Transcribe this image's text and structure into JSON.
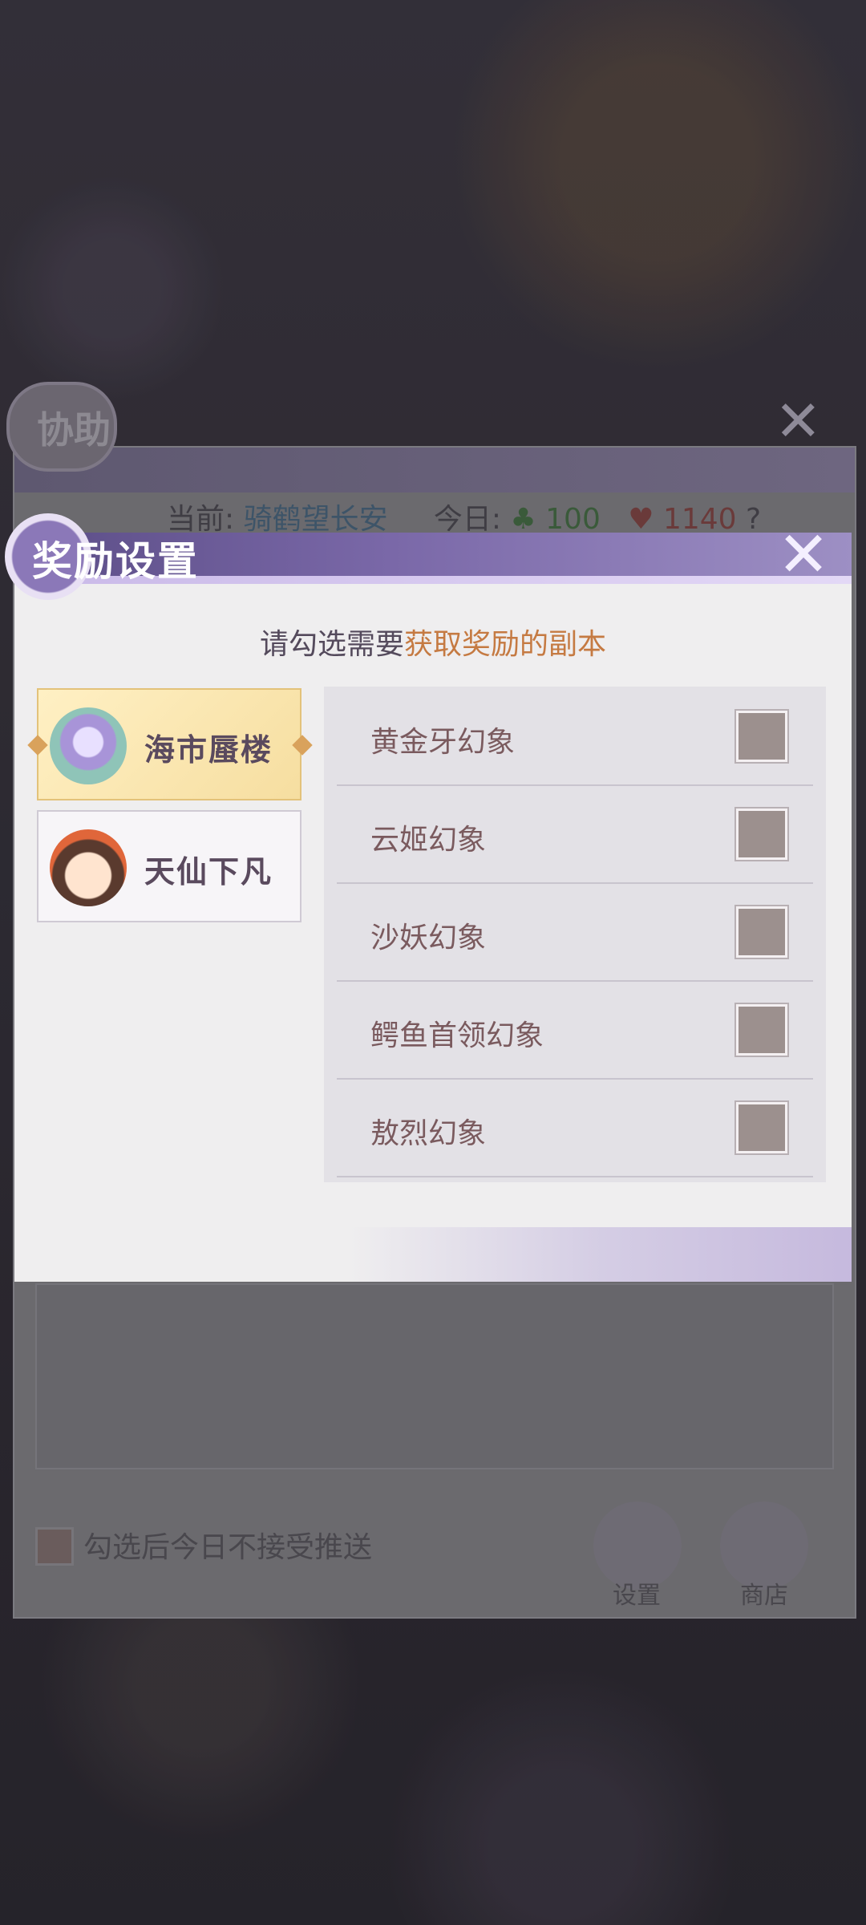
{
  "background": {
    "assist_panel": {
      "title": "协助",
      "status_prefix": "当前:",
      "current_route": "骑鹤望长安",
      "today_label": "今日:",
      "clover_count": "100",
      "heart_count": "1140",
      "help_mark": "?",
      "push_option_label": "勾选后今日不接受推送",
      "settings_button": "设置",
      "shop_button": "商店"
    }
  },
  "dialog": {
    "title": "奖励设置",
    "close_glyph": "✕",
    "instruction_prefix": "请勾选需要",
    "instruction_highlight": "获取奖励的副本",
    "categories": [
      {
        "label": "海市蜃楼",
        "selected": true
      },
      {
        "label": "天仙下凡",
        "selected": false
      }
    ],
    "items": [
      {
        "label": "黄金牙幻象",
        "checked": false
      },
      {
        "label": "云姬幻象",
        "checked": false
      },
      {
        "label": "沙妖幻象",
        "checked": false
      },
      {
        "label": "鳄鱼首领幻象",
        "checked": false
      },
      {
        "label": "敖烈幻象",
        "checked": false
      }
    ]
  },
  "colors": {
    "header_purple": "#6e5ea0",
    "highlight_orange": "#c57a42",
    "selected_card": "#f6dea0"
  }
}
